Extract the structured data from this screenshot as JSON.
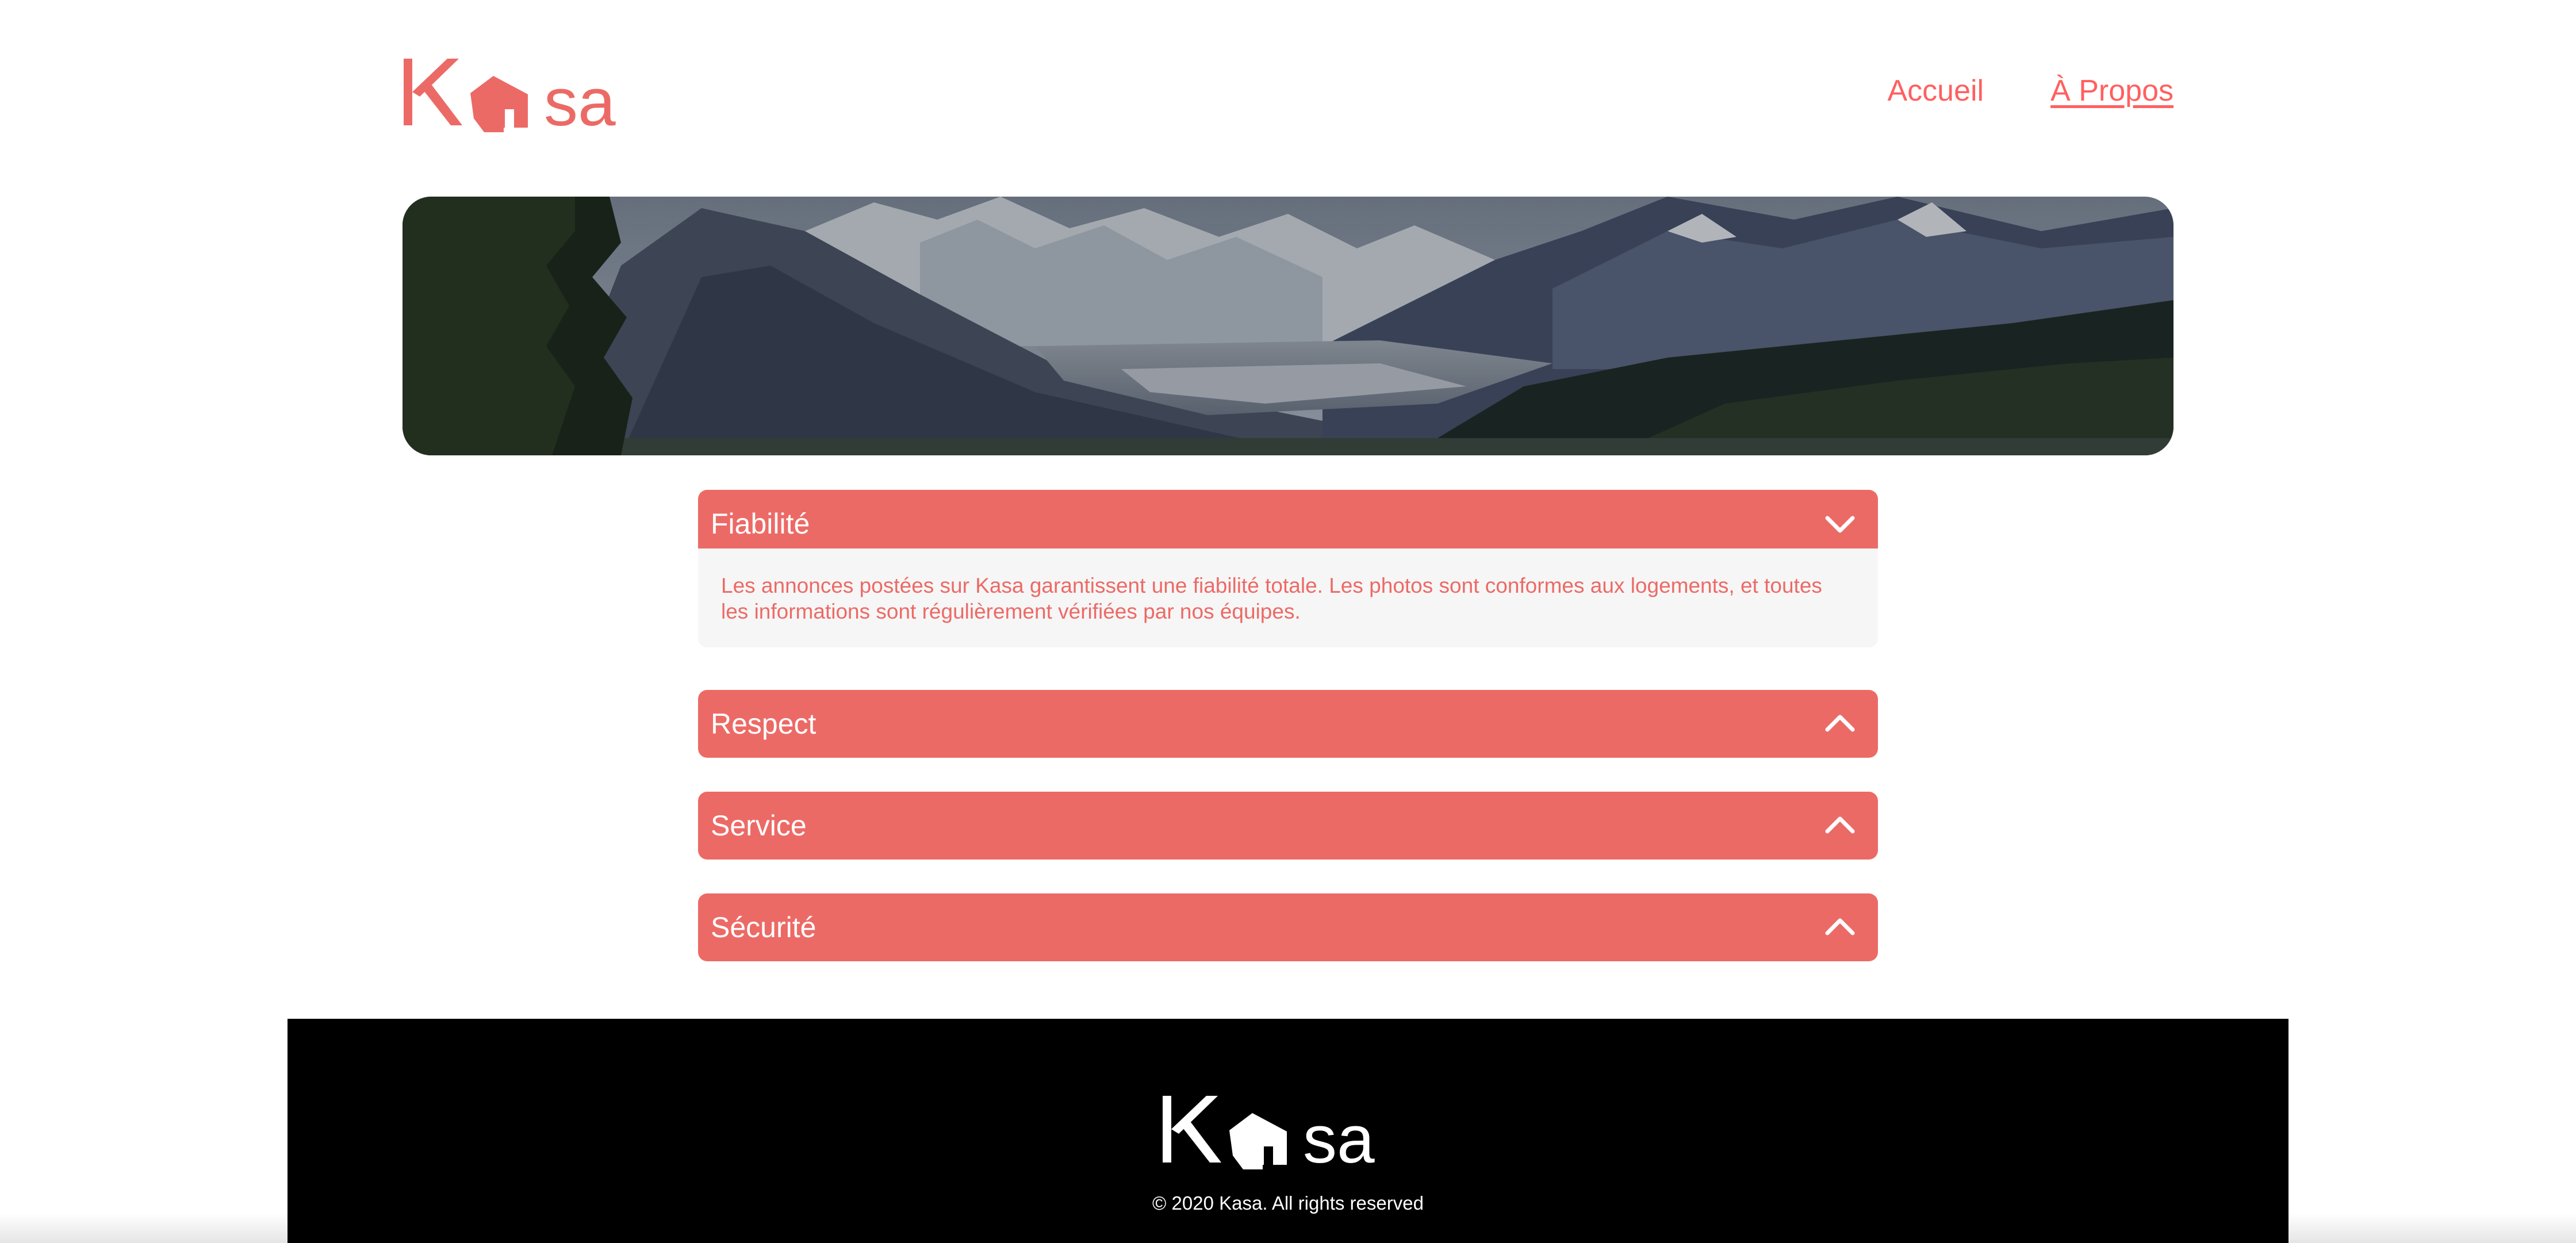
{
  "brand": {
    "name": "Kasa",
    "logo_icon": "house-icon",
    "accent_color": "#ec6a66"
  },
  "nav": {
    "items": [
      {
        "label": "Accueil",
        "active": false
      },
      {
        "label": "À Propos",
        "active": true
      }
    ]
  },
  "banner": {
    "image": "mountain-valley-landscape"
  },
  "collapses": [
    {
      "title": "Fiabilité",
      "open": true,
      "icon": "chevron-down-icon",
      "content": "Les annonces postées sur Kasa garantissent une fiabilité totale. Les photos sont conformes aux logements, et toutes les informations sont régulièrement vérifiées par nos équipes."
    },
    {
      "title": "Respect",
      "open": false,
      "icon": "chevron-up-icon"
    },
    {
      "title": "Service",
      "open": false,
      "icon": "chevron-up-icon"
    },
    {
      "title": "Sécurité",
      "open": false,
      "icon": "chevron-up-icon"
    }
  ],
  "footer": {
    "copyright": "© 2020 Kasa. All rights reserved"
  }
}
